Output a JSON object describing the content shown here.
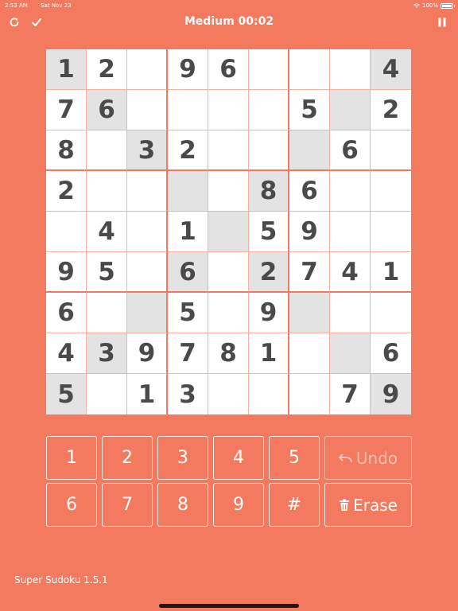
{
  "status_bar": {
    "time": "2:53 AM",
    "date": "Sat Nov 23",
    "battery": "100%",
    "battery_level": 1.0
  },
  "header": {
    "title": "Medium 00:02"
  },
  "board": {
    "cells": [
      [
        "1",
        "2",
        "",
        "9",
        "6",
        "",
        "",
        "",
        "4"
      ],
      [
        "7",
        "6",
        "",
        "",
        "",
        "",
        "5",
        "",
        "2"
      ],
      [
        "8",
        "",
        "3",
        "2",
        "",
        "",
        "",
        "6",
        ""
      ],
      [
        "2",
        "",
        "",
        "",
        "",
        "8",
        "6",
        "",
        ""
      ],
      [
        "",
        "4",
        "",
        "1",
        "",
        "5",
        "9",
        "",
        ""
      ],
      [
        "9",
        "5",
        "",
        "6",
        "",
        "2",
        "7",
        "4",
        "1"
      ],
      [
        "6",
        "",
        "",
        "5",
        "",
        "9",
        "",
        "",
        ""
      ],
      [
        "4",
        "3",
        "9",
        "7",
        "8",
        "1",
        "",
        "",
        "6"
      ],
      [
        "5",
        "",
        "1",
        "3",
        "",
        "",
        "",
        "7",
        "9"
      ]
    ],
    "shaded": [
      [
        0,
        0
      ],
      [
        0,
        8
      ],
      [
        1,
        1
      ],
      [
        1,
        7
      ],
      [
        2,
        2
      ],
      [
        2,
        6
      ],
      [
        3,
        3
      ],
      [
        3,
        5
      ],
      [
        4,
        4
      ],
      [
        5,
        3
      ],
      [
        5,
        5
      ],
      [
        6,
        2
      ],
      [
        6,
        6
      ],
      [
        7,
        1
      ],
      [
        7,
        7
      ],
      [
        8,
        0
      ],
      [
        8,
        8
      ]
    ]
  },
  "keypad": {
    "numbers": [
      "1",
      "2",
      "3",
      "4",
      "5",
      "6",
      "7",
      "8",
      "9",
      "#"
    ],
    "undo_label": "Undo",
    "erase_label": "Erase"
  },
  "footer": {
    "version": "Super Sudoku 1.5.1"
  },
  "colors": {
    "background": "#F47A5F",
    "digit": "#4A4A4A",
    "shaded": "#E3E3E3",
    "grid_line": "#F7B2A2"
  },
  "icons": {
    "refresh": "refresh-icon",
    "check": "check-icon",
    "pause": "pause-icon",
    "undo": "undo-arrow-icon",
    "erase": "trash-icon"
  }
}
